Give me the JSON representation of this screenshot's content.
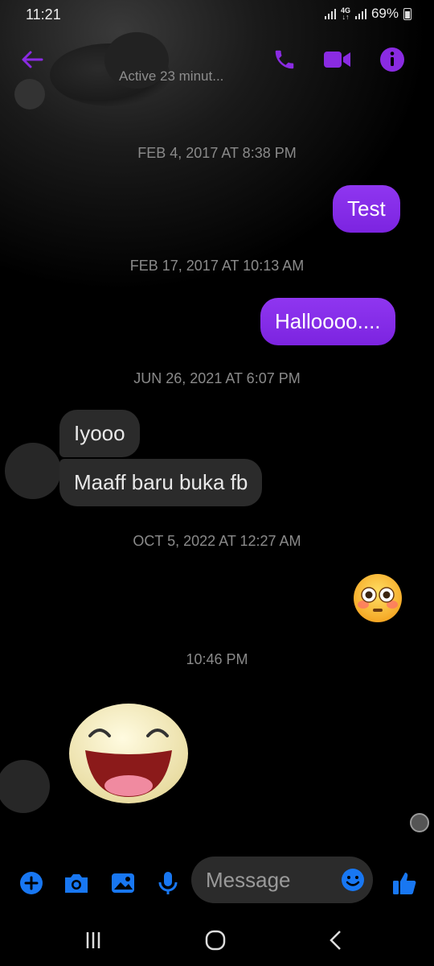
{
  "status_bar": {
    "time": "11:21",
    "network": "4G",
    "battery": "69%"
  },
  "header": {
    "active_status": "Active 23 minut..."
  },
  "accent_color": "#8a2be2",
  "icon_color": "#1877f2",
  "messages": [
    {
      "type": "timestamp",
      "text": "FEB 4, 2017 AT 8:38 PM"
    },
    {
      "type": "outgoing",
      "text": "Test"
    },
    {
      "type": "timestamp",
      "text": "FEB 17, 2017 AT 10:13 AM"
    },
    {
      "type": "outgoing",
      "text": "Halloooo...."
    },
    {
      "type": "timestamp",
      "text": "JUN 26, 2021 AT 6:07 PM"
    },
    {
      "type": "incoming",
      "text": "Iyooo"
    },
    {
      "type": "incoming",
      "text": "Maaff baru buka fb"
    },
    {
      "type": "timestamp",
      "text": "OCT 5, 2022 AT 12:27 AM"
    },
    {
      "type": "outgoing-emoji",
      "icon": "flushed-face-emoji"
    },
    {
      "type": "timestamp",
      "text": "10:46 PM"
    },
    {
      "type": "incoming-sticker",
      "icon": "laughing-face-sticker"
    }
  ],
  "composer": {
    "placeholder": "Message"
  },
  "icons": {
    "back": "back-arrow-icon",
    "call": "phone-icon",
    "video": "video-camera-icon",
    "info": "info-icon",
    "plus": "plus-icon",
    "camera": "camera-icon",
    "gallery": "image-icon",
    "mic": "microphone-icon",
    "emoji": "smiley-icon",
    "like": "thumbs-up-icon"
  }
}
